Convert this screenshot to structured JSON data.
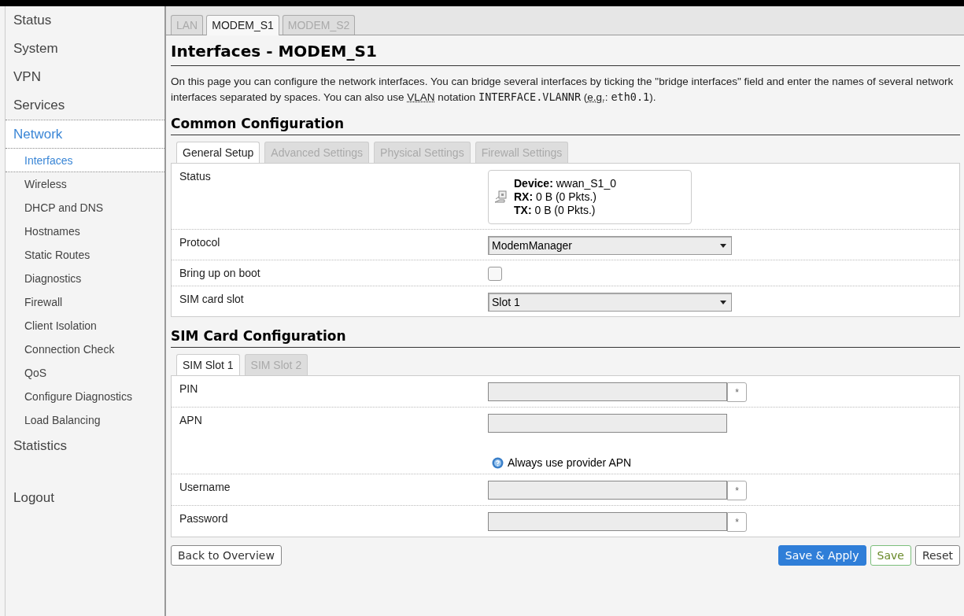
{
  "sidebar": {
    "items": [
      {
        "label": "Status",
        "selected": false
      },
      {
        "label": "System",
        "selected": false
      },
      {
        "label": "VPN",
        "selected": false
      },
      {
        "label": "Services",
        "selected": false
      },
      {
        "label": "Network",
        "selected": true,
        "children": [
          {
            "label": "Interfaces",
            "selected": true
          },
          {
            "label": "Wireless",
            "selected": false
          },
          {
            "label": "DHCP and DNS",
            "selected": false
          },
          {
            "label": "Hostnames",
            "selected": false
          },
          {
            "label": "Static Routes",
            "selected": false
          },
          {
            "label": "Diagnostics",
            "selected": false
          },
          {
            "label": "Firewall",
            "selected": false
          },
          {
            "label": "Client Isolation",
            "selected": false
          },
          {
            "label": "Connection Check",
            "selected": false
          },
          {
            "label": "QoS",
            "selected": false
          },
          {
            "label": "Configure Diagnostics",
            "selected": false
          },
          {
            "label": "Load Balancing",
            "selected": false
          }
        ]
      },
      {
        "label": "Statistics",
        "selected": false
      }
    ],
    "logout": "Logout"
  },
  "tabs": [
    {
      "label": "LAN",
      "selected": false
    },
    {
      "label": "MODEM_S1",
      "selected": true
    },
    {
      "label": "MODEM_S2",
      "selected": false
    }
  ],
  "title": "Interfaces - MODEM_S1",
  "description": [
    {
      "kind": "text",
      "text": "On this page you can configure the network interfaces. You can bridge several interfaces by ticking the \"bridge interfaces\" field and enter the names of several network interfaces separated by spaces. You can also use "
    },
    {
      "kind": "abbr",
      "text": "VLAN"
    },
    {
      "kind": "text",
      "text": " notation "
    },
    {
      "kind": "code",
      "text": "INTERFACE.VLANNR"
    },
    {
      "kind": "text",
      "text": " ("
    },
    {
      "kind": "abbr",
      "text": "e.g."
    },
    {
      "kind": "text",
      "text": ": "
    },
    {
      "kind": "code",
      "text": "eth0.1"
    },
    {
      "kind": "text",
      "text": ")."
    }
  ],
  "sections": [
    {
      "title": "Common Configuration",
      "tabs": [
        {
          "label": "General Setup",
          "selected": true
        },
        {
          "label": "Advanced Settings",
          "selected": false
        },
        {
          "label": "Physical Settings",
          "selected": false
        },
        {
          "label": "Firewall Settings",
          "selected": false
        }
      ],
      "rows": [
        {
          "kind": "status",
          "label": "Status",
          "lines": [
            {
              "key": "Device:",
              "value": "wwan_S1_0"
            },
            {
              "key": "RX:",
              "value": "0 B (0 Pkts.)"
            },
            {
              "key": "TX:",
              "value": "0 B (0 Pkts.)"
            }
          ]
        },
        {
          "kind": "select",
          "label": "Protocol",
          "value": "ModemManager"
        },
        {
          "kind": "checkbox",
          "label": "Bring up on boot",
          "checked": false
        },
        {
          "kind": "select",
          "label": "SIM card slot",
          "value": "Slot 1"
        }
      ]
    },
    {
      "title": "SIM Card Configuration",
      "tabs": [
        {
          "label": "SIM Slot 1",
          "selected": true
        },
        {
          "label": "SIM Slot 2",
          "selected": false
        }
      ],
      "rows": [
        {
          "kind": "password",
          "label": "PIN",
          "reveal": "*"
        },
        {
          "kind": "text",
          "label": "APN",
          "hint": "Always use provider APN"
        },
        {
          "kind": "password",
          "label": "Username",
          "reveal": "*"
        },
        {
          "kind": "password",
          "label": "Password",
          "reveal": "*"
        }
      ]
    }
  ],
  "buttons": {
    "back": "Back to Overview",
    "save_apply": "Save & Apply",
    "save": "Save",
    "reset": "Reset"
  }
}
